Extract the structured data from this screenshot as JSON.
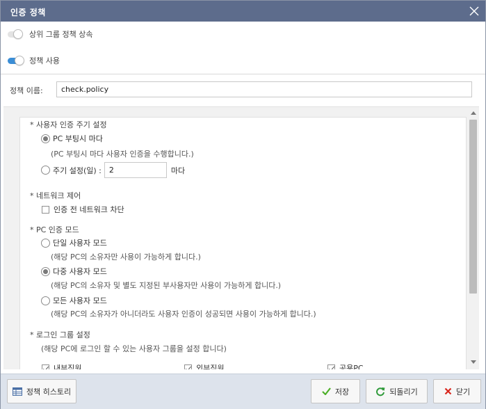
{
  "dialog": {
    "title": "인증 정책",
    "close_icon": "close-icon"
  },
  "toggles": {
    "inherit_label": "상위 그룹 정책 상속",
    "inherit_on": false,
    "use_label": "정책 사용",
    "use_on": true
  },
  "policy_name": {
    "label": "정책 이름:",
    "value": "check.policy"
  },
  "auth_cycle": {
    "title": "* 사용자 인증 주기 설정",
    "option_boot_label": "PC 부팅시 마다",
    "option_boot_desc": "(PC 부팅시 마다 사용자 인증을 수행합니다.)",
    "option_period_label": "주기 설정(일) :",
    "period_value": "2",
    "period_suffix": "마다",
    "selected": "boot"
  },
  "network": {
    "title": "* 네트워크 제어",
    "block_label": "인증 전 네트워크 차단",
    "block_checked": false
  },
  "auth_mode": {
    "title": "* PC 인증 모드",
    "single_label": "단일 사용자 모드",
    "single_desc": "(해당 PC의 소유자만 사용이 가능하게 합니다.)",
    "multi_label": "다중 사용자 모드",
    "multi_desc": "(해당 PC의 소유자 및 별도 지정된 부사용자만 사용이 가능하게 합니다.)",
    "all_label": "모든 사용자 모드",
    "all_desc": "(해당 PC의 소유자가 아니더라도 사용자 인증이 성공되면 사용이 가능하게 합니다.)",
    "selected": "multi"
  },
  "login_group": {
    "title": "* 로그인 그룹 설정",
    "desc": "(해당 PC에 로그인 할 수 있는 사용자 그룹을 설정 합니다)",
    "groups": [
      {
        "label": "내부직원",
        "checked": true
      },
      {
        "label": "외부직원",
        "checked": true
      },
      {
        "label": "공용PC",
        "checked": true
      }
    ]
  },
  "footer": {
    "history_label": "정책 히스토리",
    "save_label": "저장",
    "revert_label": "되돌리기",
    "close_label": "닫기"
  },
  "colors": {
    "titlebar": "#5d6c8c",
    "toggle_on": "#3b8ed6",
    "save_check": "#4caf28",
    "revert_icon": "#2f9a3a",
    "close_x": "#d9261c",
    "footer_bg": "#dde3ec"
  }
}
